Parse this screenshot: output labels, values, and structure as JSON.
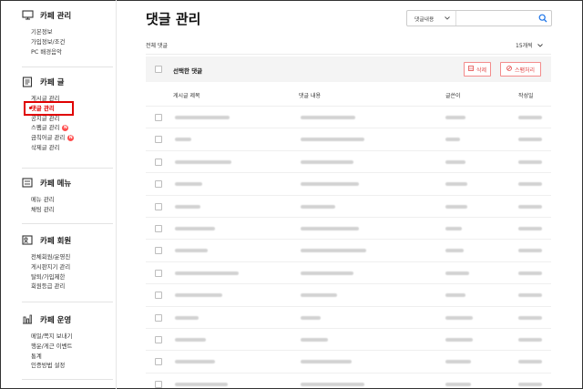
{
  "sidebar": {
    "sections": [
      {
        "title": "카페 관리",
        "icon": "monitor-icon",
        "items": [
          {
            "label": "기본정보"
          },
          {
            "label": "가입정보/조건"
          },
          {
            "label": "PC 배경음악"
          }
        ]
      },
      {
        "title": "카페 글",
        "icon": "document-icon",
        "items": [
          {
            "label": "게시글 관리"
          },
          {
            "label": "댓글 관리",
            "active": true
          },
          {
            "label": "공지글 관리"
          },
          {
            "label": "스팸글 관리",
            "badge": "N"
          },
          {
            "label": "금칙어글 관리",
            "badge": "N"
          },
          {
            "label": "삭제글 관리"
          }
        ]
      },
      {
        "title": "카페 메뉴",
        "icon": "menu-list-icon",
        "items": [
          {
            "label": "메뉴 관리"
          },
          {
            "label": "채팅 관리"
          }
        ]
      },
      {
        "title": "카페 회원",
        "icon": "member-card-icon",
        "items": [
          {
            "label": "전체회원/운영진"
          },
          {
            "label": "게시판지기 관리"
          },
          {
            "label": "탈퇴/가입제한"
          },
          {
            "label": "회원등급 관리"
          }
        ]
      },
      {
        "title": "카페 운영",
        "icon": "bar-chart-icon",
        "items": [
          {
            "label": "메일/쪽지 보내기"
          },
          {
            "label": "행운/게근 이벤트"
          },
          {
            "label": "통계"
          },
          {
            "label": "인증방법 설정"
          }
        ]
      }
    ]
  },
  "main": {
    "title": "댓글 관리",
    "search": {
      "select_label": "댓글내용",
      "placeholder": ""
    },
    "filter_label": "전체 댓글",
    "count_select": "15개씩",
    "selection": {
      "label": "선택한 댓글",
      "delete_label": "삭제",
      "spam_label": "스팸처리"
    },
    "columns": [
      "게시글 제목",
      "댓글 내용",
      "글쓴이",
      "작성일"
    ],
    "row_count": 13
  },
  "colors": {
    "accent_red": "#e24a4a",
    "highlight_box": "#e00000",
    "search_icon": "#1a73e8"
  }
}
